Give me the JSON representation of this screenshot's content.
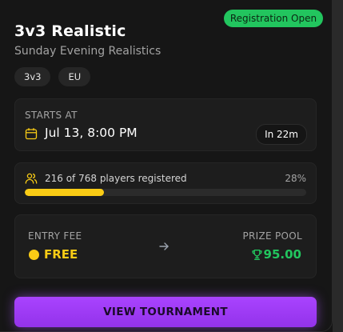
{
  "status": {
    "label": "Registration Open",
    "color": "#22c55e"
  },
  "tournament": {
    "title": "3v3 Realistic",
    "subtitle": "Sunday Evening Realistics",
    "tags": [
      "3v3",
      "EU"
    ]
  },
  "schedule": {
    "label": "STARTS AT",
    "icon": "calendar-icon",
    "datetime": "Jul 13, 8:00 PM",
    "countdown": "In 22m"
  },
  "registration": {
    "icon": "users-icon",
    "text": "216 of 768 players registered",
    "percent_label": "28%",
    "registered": 216,
    "capacity": 768,
    "progress_fraction": 0.28,
    "bar_color": "#facc15"
  },
  "entry": {
    "label": "ENTRY FEE",
    "icon": "coin-icon",
    "value": "FREE",
    "color": "#facc15"
  },
  "arrow_icon": "arrow-right-icon",
  "prize": {
    "label": "PRIZE POOL",
    "icon": "trophy-icon",
    "value": "95.00",
    "color": "#22c55e"
  },
  "cta": {
    "label": "VIEW TOURNAMENT",
    "color": "#a855f7"
  }
}
